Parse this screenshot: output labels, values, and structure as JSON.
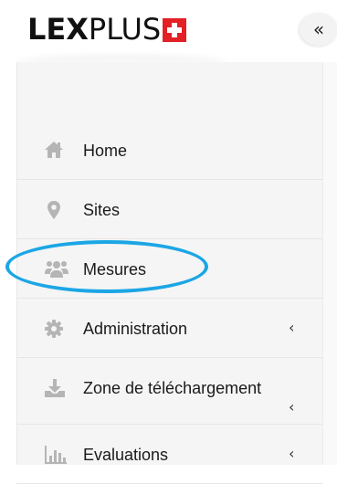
{
  "brand": {
    "logo_bold": "LEX",
    "logo_light": "PLUS",
    "accent_color": "#e32026"
  },
  "header": {
    "collapse_label": "«"
  },
  "sidebar": {
    "items": [
      {
        "label": "Home",
        "icon": "home-icon",
        "chevron": ""
      },
      {
        "label": "Sites",
        "icon": "map-marker-icon",
        "chevron": ""
      },
      {
        "label": "Mesures",
        "icon": "users-icon",
        "chevron": "",
        "highlighted": true
      },
      {
        "label": "Administration",
        "icon": "gear-icon",
        "chevron": "‹"
      },
      {
        "label": "Zone de téléchargement",
        "icon": "download-icon",
        "chevron": "‹"
      },
      {
        "label": "Evaluations",
        "icon": "bar-chart-icon",
        "chevron": "‹"
      }
    ]
  },
  "colors": {
    "sidebar_bg": "#f5f5f5",
    "icon_gray": "#b5b5b5",
    "highlight": "#1ba6e5"
  }
}
